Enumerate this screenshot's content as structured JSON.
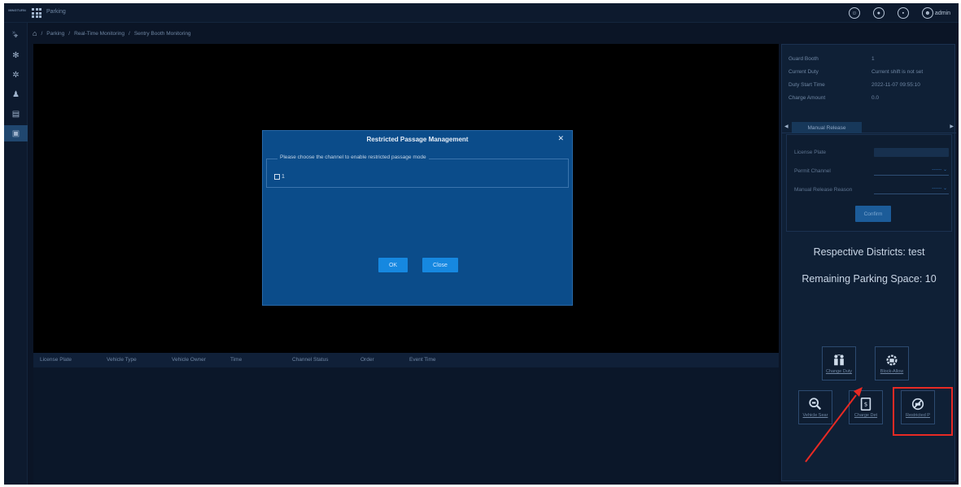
{
  "topbar": {
    "logo_text": "MINGTURN",
    "app_name": "Parking",
    "user": "admin"
  },
  "breadcrumb": [
    "Parking",
    "Real-Time Monitoring",
    "Sentry Booth Monitoring"
  ],
  "table": {
    "columns": [
      "License Plate",
      "Vehicle Type",
      "Vehicle Owner",
      "Time",
      "Channel Status",
      "Order",
      "Event Time"
    ]
  },
  "info": [
    {
      "label": "Guard Booth",
      "value": "1"
    },
    {
      "label": "Current Duty",
      "value": "Current shift is not set"
    },
    {
      "label": "Duty Start Time",
      "value": "2022-11-07 09:55:10"
    },
    {
      "label": "Charge Amount",
      "value": "0.0"
    }
  ],
  "manual_release": {
    "tab": "Manual Release",
    "license_plate_label": "License Plate",
    "permit_channel_label": "Permit Channel",
    "permit_channel_value": "------",
    "reason_label": "Manual Release Reason",
    "reason_value": "------",
    "confirm_label": "Confirm"
  },
  "districts_text": "Respective Districts: test",
  "remaining_text": "Remaining Parking Space: 10",
  "functions": {
    "change_duty": "Change Duty",
    "block_allow": "Block-Allow",
    "vehicle_search": "Vehicle Sear",
    "charge_detail": "Charge Det",
    "restricted": "Restricted P"
  },
  "modal": {
    "title": "Restricted Passage Management",
    "prompt": "Please choose the channel to enable restricted passage mode",
    "channel_label": "1",
    "ok_label": "OK",
    "close_label": "Close"
  },
  "colors": {
    "background": "#0b1526",
    "modal": "#0b4c8a",
    "button_primary": "#1688e0",
    "highlight": "#e82a24"
  }
}
